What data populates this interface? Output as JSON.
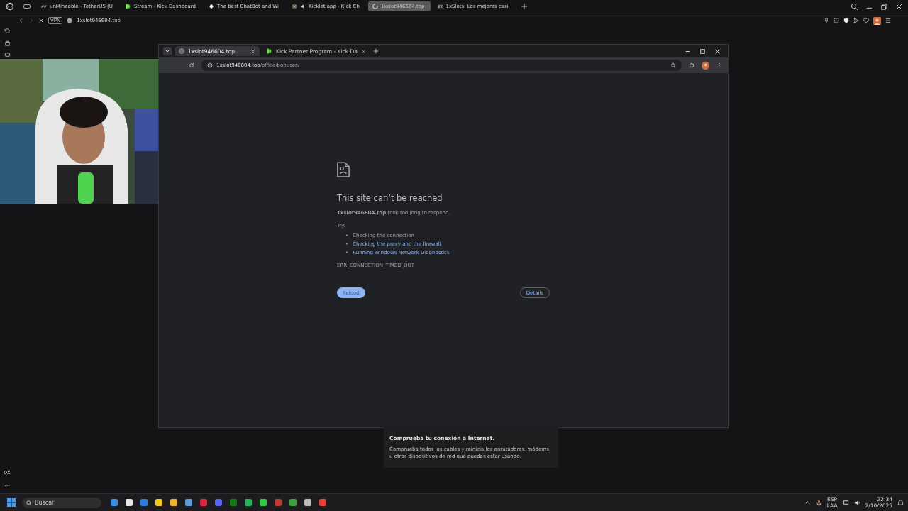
{
  "outer_browser": {
    "tabs": [
      {
        "label": "unMineable - TetherUS (U",
        "selected": false
      },
      {
        "label": "Stream - Kick Dashboard",
        "selected": false
      },
      {
        "label": "The best ChatBot and Wi",
        "selected": false
      },
      {
        "label": "Kicklet.app - Kick Ch",
        "selected": false
      },
      {
        "label": "1xslot946604.top",
        "selected": true
      },
      {
        "label": "1xSlots: Los mejores casi",
        "selected": false
      }
    ],
    "vpn_badge": "VPN",
    "address": "1xslot946604.top"
  },
  "inner_browser": {
    "tabs": [
      {
        "label": "1xslot946604.top",
        "selected": true
      },
      {
        "label": "Kick Partner Program - Kick Da",
        "selected": false
      }
    ],
    "address_host": "1xslot946604.top",
    "address_path": "/office/bonuses/",
    "error": {
      "title": "This site can’t be reached",
      "message": "**1xslot946604.top** took too long to respond.",
      "try_label": "Try:",
      "suggestions": [
        {
          "bullet": "•",
          "text": "Checking the connection",
          "kind": "plain"
        },
        {
          "bullet": "•",
          "text": "Checking the proxy and the firewall",
          "kind": "link"
        },
        {
          "bullet": "•",
          "text": "Running Windows Network Diagnostics",
          "kind": "link"
        }
      ],
      "code": "ERR_CONNECTION_TIMED_OUT",
      "reload_button": "Reload",
      "details_button": "Details"
    }
  },
  "webcam": {
    "kind": "picture"
  },
  "notification": {
    "title": "Comprueba tu conexión a Internet.",
    "body": "Comprueba todos los cables y reinicia los enrutadores, módems u otros dispositivos de red que puedas estar usando."
  },
  "corner_texts": [
    "ox",
    "..."
  ],
  "taskbar": {
    "search_placeholder": "Buscar",
    "language": "ESP",
    "layout": "LAA",
    "time": "22:34",
    "date": "2/10/2025"
  }
}
